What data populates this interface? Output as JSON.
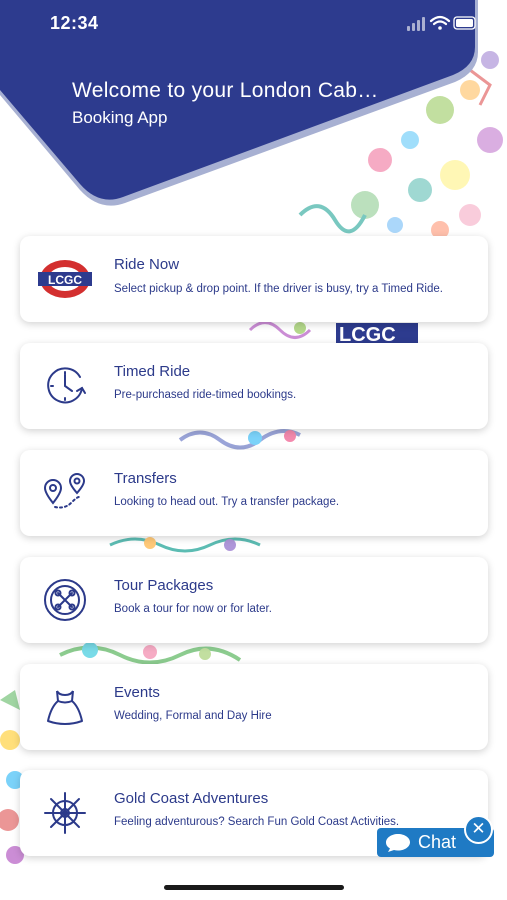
{
  "status_bar": {
    "time": "12:34"
  },
  "header": {
    "title": "Welcome to your London Cab…",
    "subtitle": "Booking App",
    "background_logo_text": "LCGC",
    "color": "#2d3b8e"
  },
  "services": [
    {
      "icon": "lcgc-logo-icon",
      "title": "Ride Now",
      "description": "Select pickup & drop point. If the driver is busy, try a Timed Ride."
    },
    {
      "icon": "clock-icon",
      "title": "Timed Ride",
      "description": "Pre-purchased ride-timed bookings."
    },
    {
      "icon": "map-pins-icon",
      "title": "Transfers",
      "description": "Looking to head out. Try a transfer package."
    },
    {
      "icon": "tour-badge-icon",
      "title": "Tour Packages",
      "description": "Book a tour for now or for later."
    },
    {
      "icon": "dress-icon",
      "title": "Events",
      "description": "Wedding, Formal and Day Hire"
    },
    {
      "icon": "ship-wheel-icon",
      "title": "Gold Coast Adventures",
      "description": "Feeling adventurous? Search Fun Gold Coast Activities."
    }
  ],
  "chat": {
    "label": "Chat",
    "close_symbol": "✕",
    "color": "#1f7ac4"
  }
}
